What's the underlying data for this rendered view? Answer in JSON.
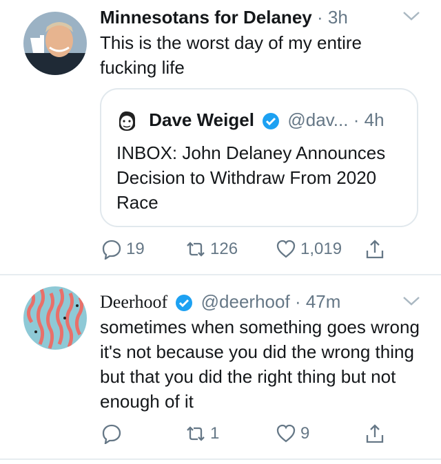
{
  "tweets": [
    {
      "name": "Minnesotans for Delaney",
      "dot": "·",
      "time": "3h",
      "text": "This is the worst day of my entire fucking life",
      "quote": {
        "name": "Dave Weigel",
        "handle": "@dav...",
        "dot": "·",
        "time": "4h",
        "text": "INBOX: John Delaney Announces Decision to Withdraw From 2020 Race"
      },
      "actions": {
        "reply": "19",
        "retweet": "126",
        "like": "1,019"
      }
    },
    {
      "name": "Deerhoof",
      "handle": "@deerhoof",
      "dot": "·",
      "time": "47m",
      "text": "sometimes when something goes wrong it's not because you did the wrong thing but that you did the right thing but not enough of it",
      "actions": {
        "reply": "",
        "retweet": "1",
        "like": "9"
      }
    }
  ],
  "icons": [
    "reply-icon",
    "retweet-icon",
    "like-icon",
    "share-icon",
    "verified-badge-icon",
    "chevron-down-icon"
  ],
  "colors": {
    "text": "#14171a",
    "secondary": "#657786",
    "verified": "#1da1f2",
    "divider": "#e6ecf0"
  }
}
